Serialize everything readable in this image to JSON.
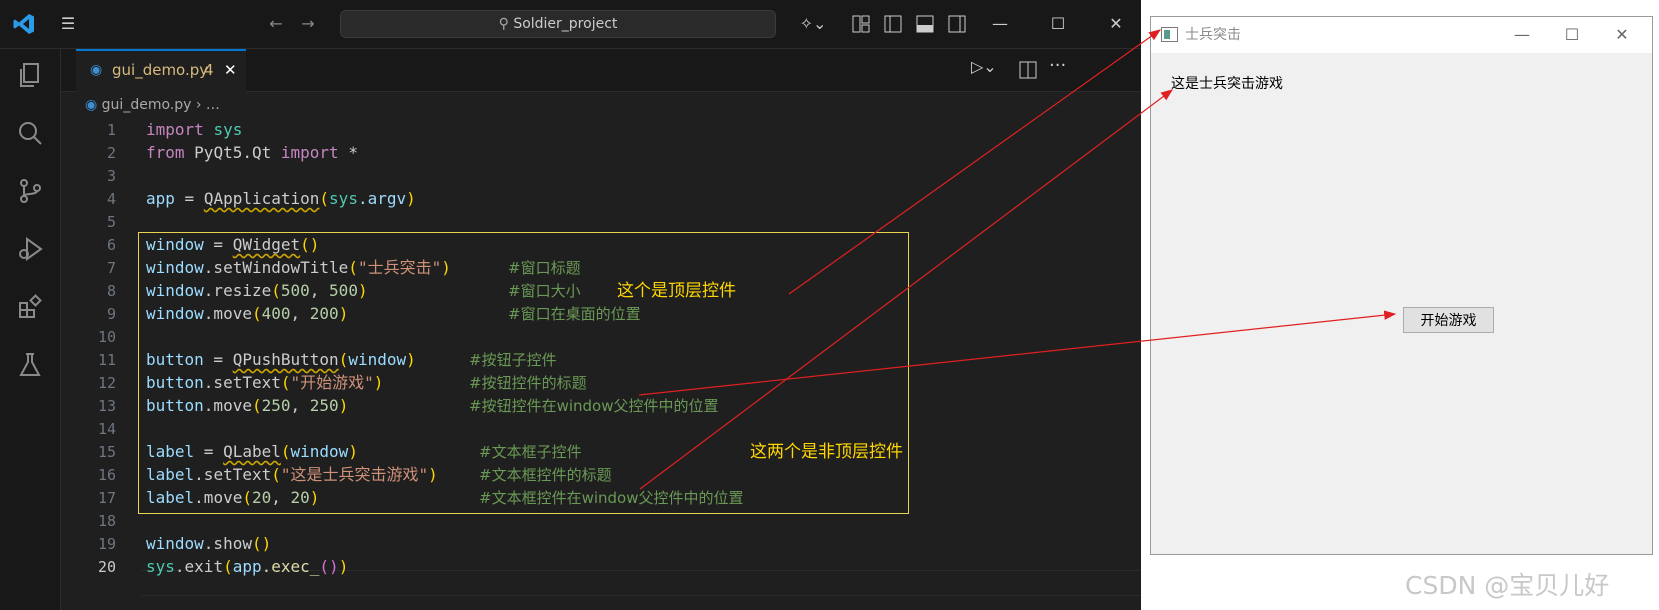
{
  "titlebar": {
    "search_text": "Soldier_project"
  },
  "tabs": {
    "active_tab_name": "gui_demo.py",
    "active_tab_problems": "4",
    "close_glyph": "✕"
  },
  "breadcrumb": {
    "file": "gui_demo.py",
    "rest": "…"
  },
  "editor": {
    "current_line": "20",
    "line_numbers": [
      "1",
      "2",
      "3",
      "4",
      "5",
      "6",
      "7",
      "8",
      "9",
      "10",
      "11",
      "12",
      "13",
      "14",
      "15",
      "16",
      "17",
      "18",
      "19",
      "20"
    ],
    "code": {
      "l1_kw": "import",
      "l1_mod": "sys",
      "l2_kw": "from",
      "l2_mod": "PyQt5.Qt",
      "l2_kw2": "import",
      "l2_star": "*",
      "l4_var": "app",
      "l4_op": " = ",
      "l4_fn": "QApplication",
      "l4_arg_mod": "sys",
      "l4_arg_attr": ".argv",
      "l6_var": "window",
      "l6_op": " = ",
      "l6_fn": "QWidget",
      "l7_var": "window",
      "l7_fn": ".setWindowTitle",
      "l7_str": "\"士兵突击\"",
      "l8_var": "window",
      "l8_fn": ".resize",
      "l8_n1": "500",
      "l8_n2": "500",
      "l9_var": "window",
      "l9_fn": ".move",
      "l9_n1": "400",
      "l9_n2": "200",
      "l11_var": "button",
      "l11_op": " = ",
      "l11_fn": "QPushButton",
      "l11_arg": "window",
      "l12_var": "button",
      "l12_fn": ".setText",
      "l12_str": "\"开始游戏\"",
      "l13_var": "button",
      "l13_fn": ".move",
      "l13_n1": "250",
      "l13_n2": "250",
      "l15_var": "label",
      "l15_op": " = ",
      "l15_fn": "QLabel",
      "l15_arg": "window",
      "l16_var": "label",
      "l16_fn": ".setText",
      "l16_str": "\"这是士兵突击游戏\"",
      "l17_var": "label",
      "l17_fn": ".move",
      "l17_n1": "20",
      "l17_n2": "20",
      "l19_var": "window",
      "l19_fn": ".show",
      "l20_mod": "sys",
      "l20_fn": ".exit",
      "l20_arg_var": "app",
      "l20_arg_fn": ".exec_"
    },
    "comments": {
      "l7": "#窗口标题",
      "l8": "#窗口大小",
      "l9": "#窗口在桌面的位置",
      "l11": "#按钮子控件",
      "l12": "#按钮控件的标题",
      "l13": "#按钮控件在window父控件中的位置",
      "l15": "#文本框子控件",
      "l16": "#文本框控件的标题",
      "l17": "#文本框控件在window父控件中的位置"
    }
  },
  "annotations": {
    "top_level": "这个是顶层控件",
    "non_top_level": "这两个是非顶层控件"
  },
  "qt_window": {
    "title": "士兵突击",
    "label_text": "这是士兵突击游戏",
    "button_text": "开始游戏",
    "minimize_glyph": "—",
    "maximize_glyph": "☐",
    "close_glyph": "✕"
  },
  "watermark": "CSDN @宝贝儿好",
  "colors": {
    "editor_bg": "#1f1f1f",
    "annotation_yellow": "#ffd700",
    "arrow_red": "#e02020",
    "accent_blue": "#0078d4"
  }
}
